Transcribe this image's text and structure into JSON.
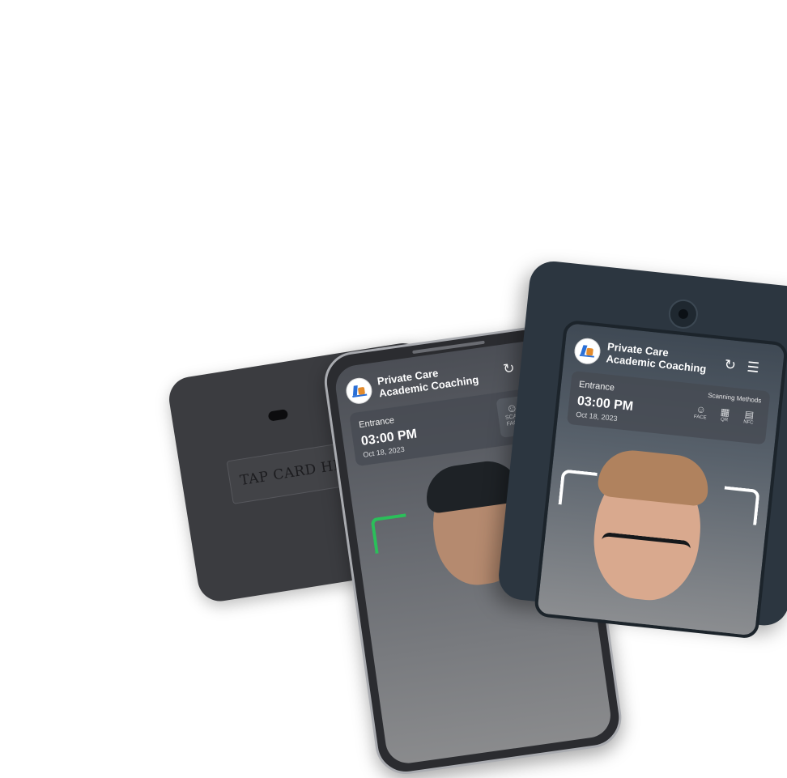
{
  "reader": {
    "tap_label": "TAP CARD HERE"
  },
  "app": {
    "title_line1": "Private Care",
    "title_line2": "Academic Coaching",
    "refresh_icon": "refresh-icon",
    "menu_icon": "menu-icon"
  },
  "phone": {
    "gate": "Entrance",
    "time": "03:00 PM",
    "date": "Oct 18, 2023",
    "scan_button_line1": "SCAN",
    "scan_button_line2": "FACE"
  },
  "kiosk": {
    "gate": "Entrance",
    "time": "03:00 PM",
    "date": "Oct 18, 2023",
    "methods_label": "Scanning Methods",
    "methods": [
      "FACE",
      "QR",
      "NFC"
    ]
  },
  "colors": {
    "accent_green": "#2bbf5a",
    "device_dark": "#2c3640",
    "reader_gray": "#3b3c40"
  }
}
